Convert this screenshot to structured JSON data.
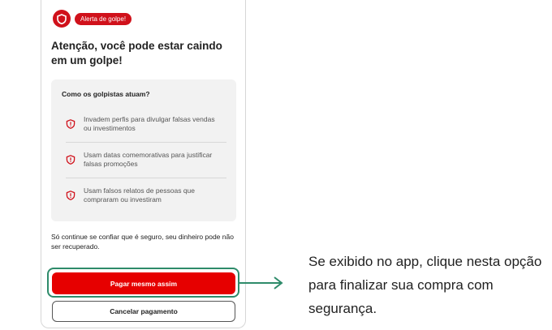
{
  "alert": {
    "badge_label": "Alerta de golpe!",
    "title": "Atenção, você pode estar caindo em um golpe!"
  },
  "scam_info": {
    "heading": "Como os golpistas atuam?",
    "items": [
      {
        "icon": "shield-alert-icon",
        "text": "Invadem perfis para divulgar falsas vendas ou investimentos"
      },
      {
        "icon": "shield-alert-icon",
        "text": "Usam datas comemorativas para justificar falsas promoções"
      },
      {
        "icon": "shield-alert-icon",
        "text": "Usam falsos relatos de pessoas que compraram ou investiram"
      }
    ]
  },
  "warning_text": "Só continue se confiar que é seguro, seu dinheiro pode não ser recuperado.",
  "actions": {
    "pay_label": "Pagar mesmo assim",
    "cancel_label": "Cancelar pagamento"
  },
  "callout_text": "Se exibido no app, clique nesta opção para finalizar sua compra com segurança.",
  "colors": {
    "brand_red": "#d0111b",
    "button_red": "#e60000",
    "highlight_green": "#2e8b6a"
  }
}
